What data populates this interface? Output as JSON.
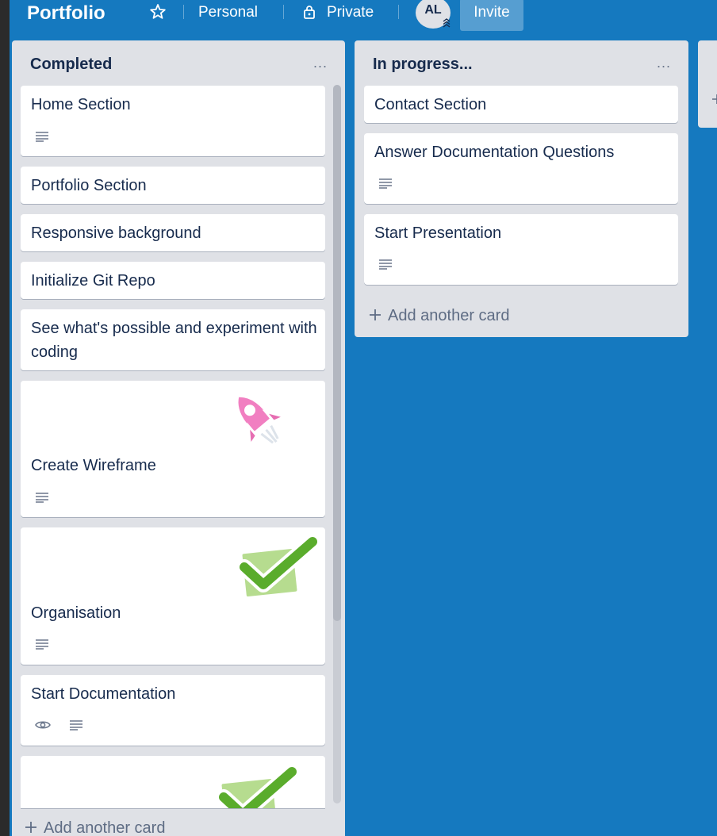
{
  "header": {
    "board_title": "Portfolio",
    "team": "Personal",
    "visibility": "Private",
    "member_initials": "AL",
    "invite_label": "Invite"
  },
  "colors": {
    "board_bg": "#1579bf",
    "list_bg": "#dfe1e6",
    "text": "#172b4d"
  },
  "lists": [
    {
      "title": "Completed",
      "menu": "...",
      "cards": [
        {
          "title": "Home Section",
          "icons": [
            "description-icon"
          ]
        },
        {
          "title": "Portfolio Section"
        },
        {
          "title": "Responsive background"
        },
        {
          "title": "Initialize Git Repo"
        },
        {
          "title": "See what's possible and experiment with coding"
        },
        {
          "title": "Create Wireframe",
          "sticker": "rocket-sticker",
          "icons": [
            "description-icon"
          ]
        },
        {
          "title": "Organisation",
          "sticker": "check-sticker",
          "icons": [
            "description-icon"
          ]
        },
        {
          "title": "Start Documentation",
          "icons": [
            "watch-icon",
            "description-icon"
          ]
        },
        {
          "title": "",
          "sticker": "check-sticker"
        }
      ],
      "add_card": "Add another card"
    },
    {
      "title": "In progress...",
      "menu": "...",
      "cards": [
        {
          "title": "Contact Section"
        },
        {
          "title": "Answer Documentation Questions",
          "icons": [
            "description-icon"
          ]
        },
        {
          "title": "Start Presentation",
          "icons": [
            "description-icon"
          ]
        }
      ],
      "add_card": "Add another card"
    }
  ]
}
